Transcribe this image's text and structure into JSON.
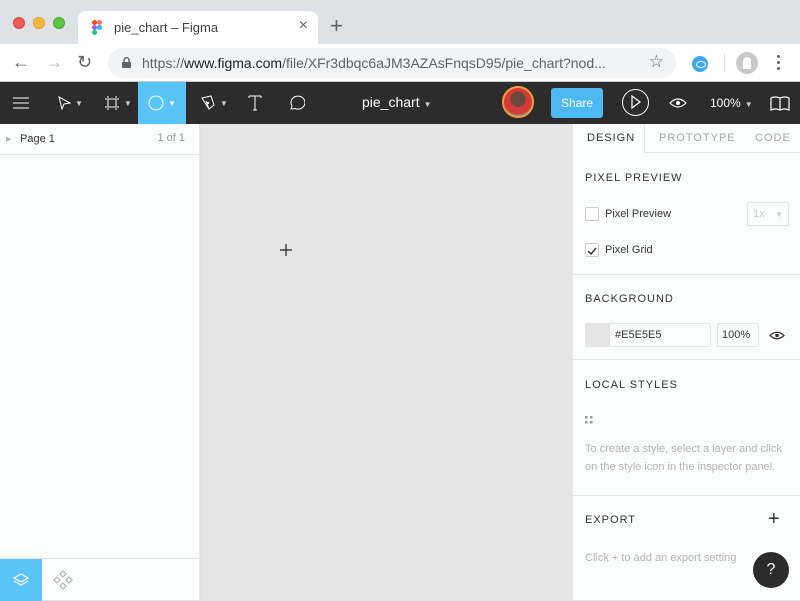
{
  "browser": {
    "tab_title": "pie_chart – Figma",
    "tab_close": "×",
    "new_tab": "+",
    "back": "←",
    "forward": "→",
    "reload": "↻",
    "url_scheme": "https://",
    "url_host": "www.figma.com",
    "url_path": "/file/XFr3dbqc6aJM3AZAsFnqsD95/pie_chart?nod...",
    "bookmark_star": "☆"
  },
  "figma_toolbar": {
    "file_name": "pie_chart",
    "share_label": "Share",
    "zoom_level": "100%",
    "active_tool": "ellipse",
    "accent_color": "#5BC4F7"
  },
  "left_panel": {
    "page_name": "Page 1",
    "page_count": "1 of 1"
  },
  "right_panel": {
    "tabs": [
      {
        "label": "DESIGN",
        "active": true
      },
      {
        "label": "PROTOTYPE",
        "active": false
      },
      {
        "label": "CODE",
        "active": false
      }
    ],
    "pixel_preview": {
      "title": "PIXEL PREVIEW",
      "pixel_preview_label": "Pixel Preview",
      "pixel_preview_checked": false,
      "scale_value": "1x",
      "pixel_grid_label": "Pixel Grid",
      "pixel_grid_checked": true
    },
    "background": {
      "title": "BACKGROUND",
      "hex": "#E5E5E5",
      "opacity": "100%"
    },
    "local_styles": {
      "title": "LOCAL STYLES",
      "hint": "To create a style, select a layer and click on the style icon in the inspector panel."
    },
    "export": {
      "title": "EXPORT",
      "add": "+",
      "hint": "Click + to add an export setting"
    },
    "help": "?"
  }
}
